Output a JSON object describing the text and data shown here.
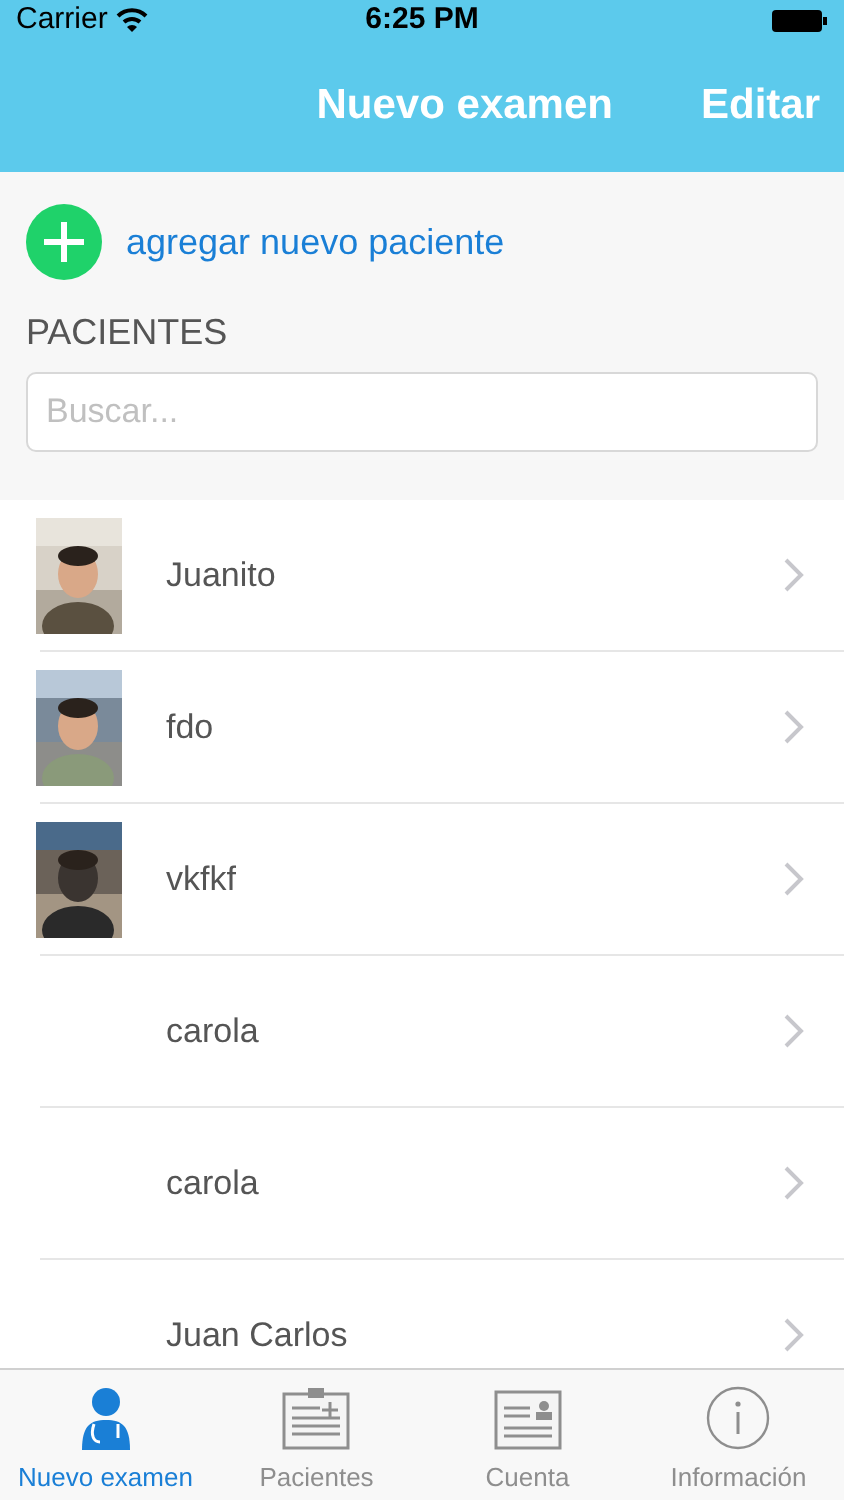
{
  "status_bar": {
    "carrier": "Carrier",
    "time": "6:25 PM"
  },
  "nav_bar": {
    "title": "Nuevo examen",
    "action": "Editar"
  },
  "add_patient": {
    "label": "agregar nuevo paciente"
  },
  "section_title": "PACIENTES",
  "search": {
    "placeholder": "Buscar..."
  },
  "patients": [
    {
      "name": "Juanito",
      "has_photo": true
    },
    {
      "name": "fdo",
      "has_photo": true
    },
    {
      "name": "vkfkf",
      "has_photo": true
    },
    {
      "name": "carola",
      "has_photo": false
    },
    {
      "name": "carola",
      "has_photo": false
    },
    {
      "name": "Juan Carlos",
      "has_photo": false
    }
  ],
  "tab_bar": [
    {
      "label": "Nuevo examen",
      "kind": "doctor",
      "selected": true
    },
    {
      "label": "Pacientes",
      "kind": "clipboard",
      "selected": false
    },
    {
      "label": "Cuenta",
      "kind": "card",
      "selected": false
    },
    {
      "label": "Información",
      "kind": "info",
      "selected": false
    }
  ]
}
